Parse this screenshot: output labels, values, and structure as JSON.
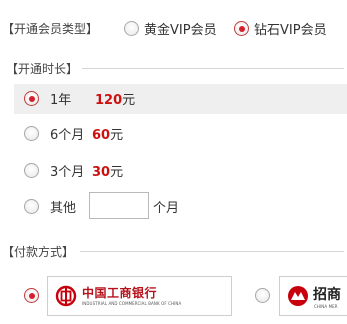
{
  "membership": {
    "title": "【开通会员类型】",
    "options": [
      {
        "label": "黄金VIP会员",
        "checked": false
      },
      {
        "label": "钻石VIP会员",
        "checked": true
      }
    ]
  },
  "duration": {
    "title": "【开通时长】",
    "options": [
      {
        "label": "1年",
        "price": "120",
        "unit": "元",
        "checked": true
      },
      {
        "label": "6个月",
        "price": "60",
        "unit": "元",
        "checked": false
      },
      {
        "label": "3个月",
        "price": "30",
        "unit": "元",
        "checked": false
      }
    ],
    "other": {
      "label": "其他",
      "value": "",
      "suffix": "个月",
      "checked": false
    }
  },
  "payment": {
    "title": "【付款方式】",
    "banks": [
      {
        "name": "中国工商银行",
        "sub": "INDUSTRIAL AND COMMERCIAL BANK OF CHINA",
        "icon": "icbc-logo-icon",
        "checked": true,
        "brand_color": "#c7000b"
      },
      {
        "name": "招商",
        "sub": "CHINA MER",
        "icon": "cmb-logo-icon",
        "checked": false,
        "brand_color": "#c7000b"
      }
    ]
  },
  "colors": {
    "accent": "#d4202c",
    "price": "#cc1111",
    "highlight": "#efefef"
  }
}
